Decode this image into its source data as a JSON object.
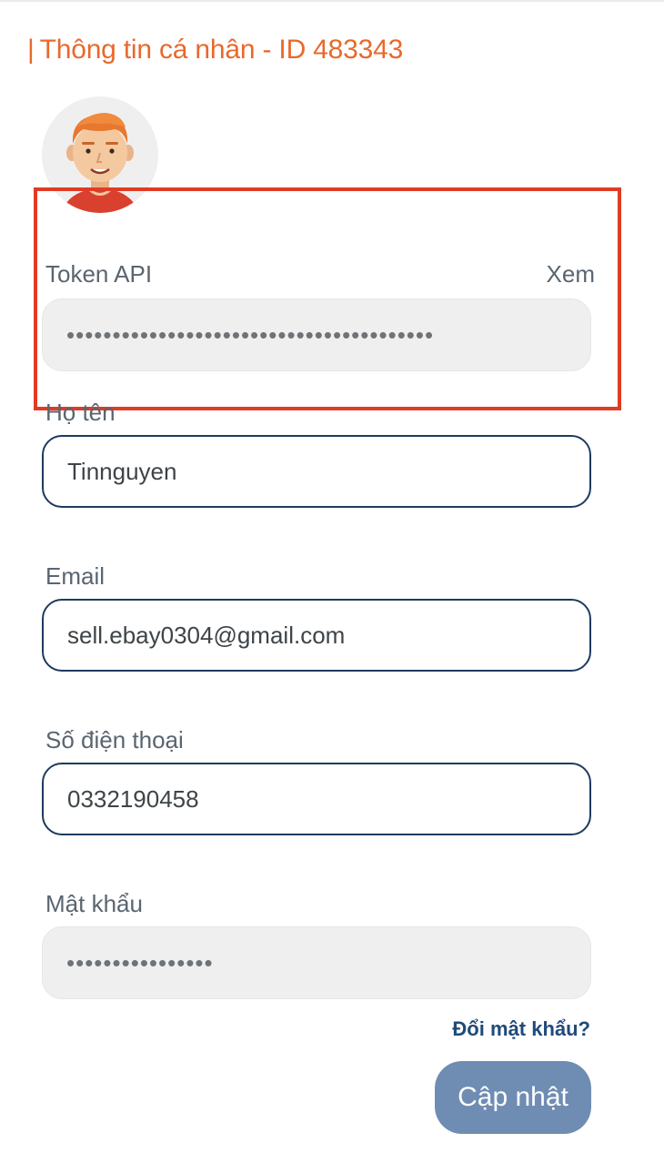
{
  "header": {
    "title_bar": "|",
    "title": "Thông tin cá nhân - ID 483343"
  },
  "avatar": {
    "alt": "avatar"
  },
  "token": {
    "label": "Token API",
    "view_label": "Xem",
    "value": "••••••••••••••••••••••••••••••••••••••••"
  },
  "form": {
    "name_label": "Họ tên",
    "name_value": "Tinnguyen",
    "email_label": "Email",
    "email_value": "sell.ebay0304@gmail.com",
    "phone_label": "Số điện thoại",
    "phone_value": "0332190458",
    "password_label": "Mật khẩu",
    "password_value": "••••••••••••••••",
    "change_password_link": "Đổi mật khẩu?",
    "submit_label": "Cập nhật"
  },
  "colors": {
    "title": "#e8692c",
    "highlight_border": "#e03b24",
    "input_border": "#1e3a5f",
    "button_bg": "#6f8db3",
    "link": "#1f4a7a"
  }
}
